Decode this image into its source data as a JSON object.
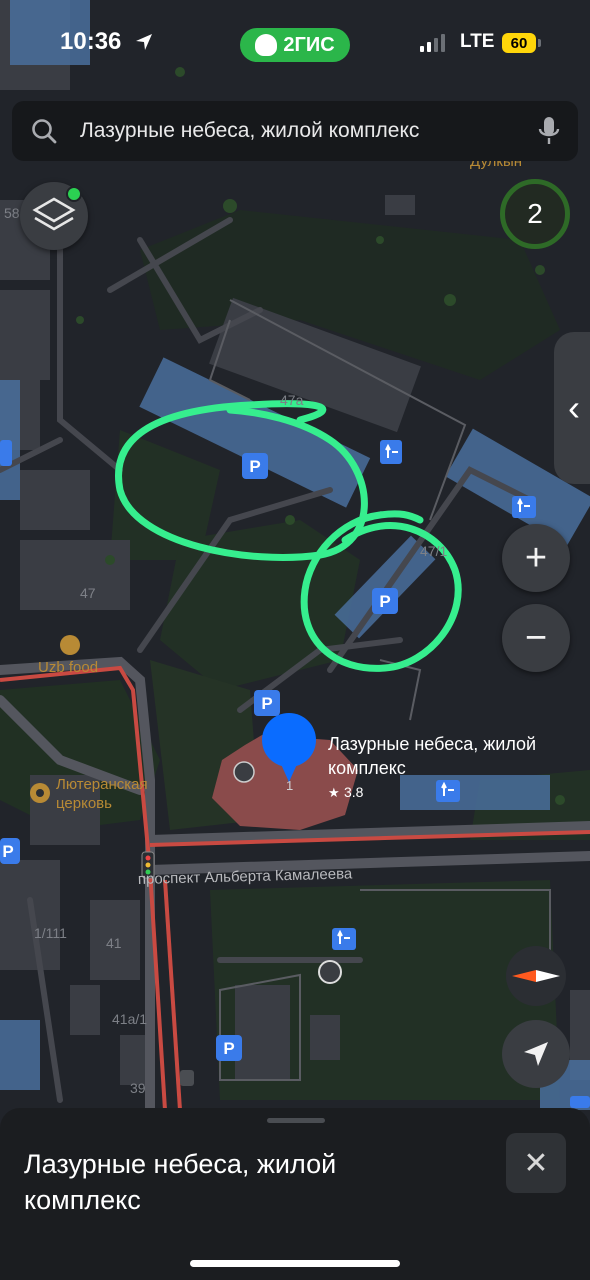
{
  "status": {
    "time": "10:36",
    "brand": "2ГИС",
    "network": "LTE",
    "battery": "60"
  },
  "search": {
    "query": "Лазурные небеса, жилой комплекс"
  },
  "map": {
    "labels": {
      "dulkyn": "Дулкын",
      "house_58": "58",
      "house_47a": "47а",
      "house_47": "47",
      "house_47_1": "47/1",
      "uzb_food": "Uzb food",
      "church_line1": "Лютеранская",
      "church_line2": "церковь",
      "complex_line1": "Лазурные небеса, жилой",
      "complex_line2": "комплекс",
      "rating": "3.8",
      "entrance_1": "1",
      "street": "проспект Альберта Камалеева",
      "house_1_111": "1/111",
      "house_41": "41",
      "house_41a_1": "41а/1",
      "house_39": "39"
    },
    "parking_letter": "P",
    "score": "2"
  },
  "controls": {
    "zoom_in": "+",
    "zoom_out": "−",
    "side_tab": "‹"
  },
  "sheet": {
    "title": "Лазурные небеса, жилой комплекс",
    "close": "✕"
  },
  "colors": {
    "accent_green": "#2bb64a",
    "pin_blue": "#0a6cff",
    "highlight": "#36ee8e",
    "building_blue": "#4a6f9e",
    "complex_red": "#8a4b4b"
  }
}
